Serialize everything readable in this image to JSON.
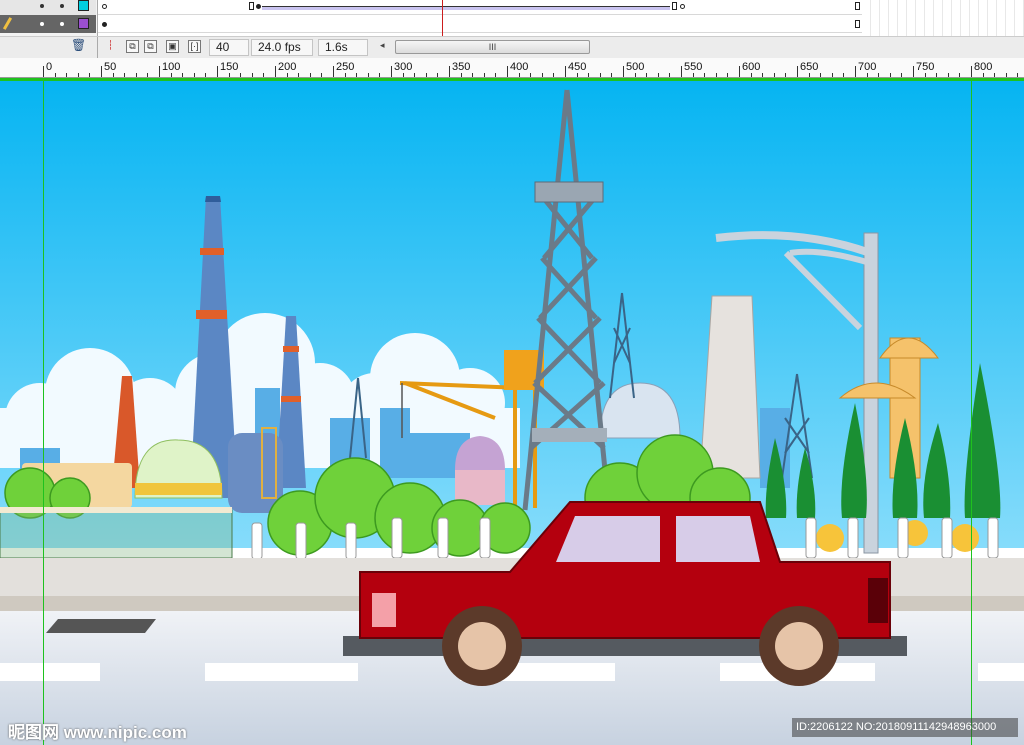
{
  "timeline": {
    "frame_number": "40",
    "fps": "24.0 fps",
    "elapsed": "1.6s",
    "scroll_thumb": "III",
    "scroll_left_arrow": "◂",
    "layer1_color": "#00cfe0",
    "layer2_color": "#9b4fd0",
    "playhead_color": "#cc1d1d"
  },
  "ruler": {
    "labels": [
      "0",
      "50",
      "100",
      "150",
      "200",
      "250",
      "300",
      "350",
      "400",
      "450",
      "500",
      "550",
      "600",
      "650",
      "700",
      "750",
      "800"
    ]
  },
  "stage": {
    "sky_color": "#19b8ee",
    "car_color": "#b4000e",
    "guide_color": "#1ec21e"
  },
  "watermark": {
    "left": "昵图网 www.nipic.com",
    "right": "ID:2206122 NO:20180911142948963000"
  }
}
